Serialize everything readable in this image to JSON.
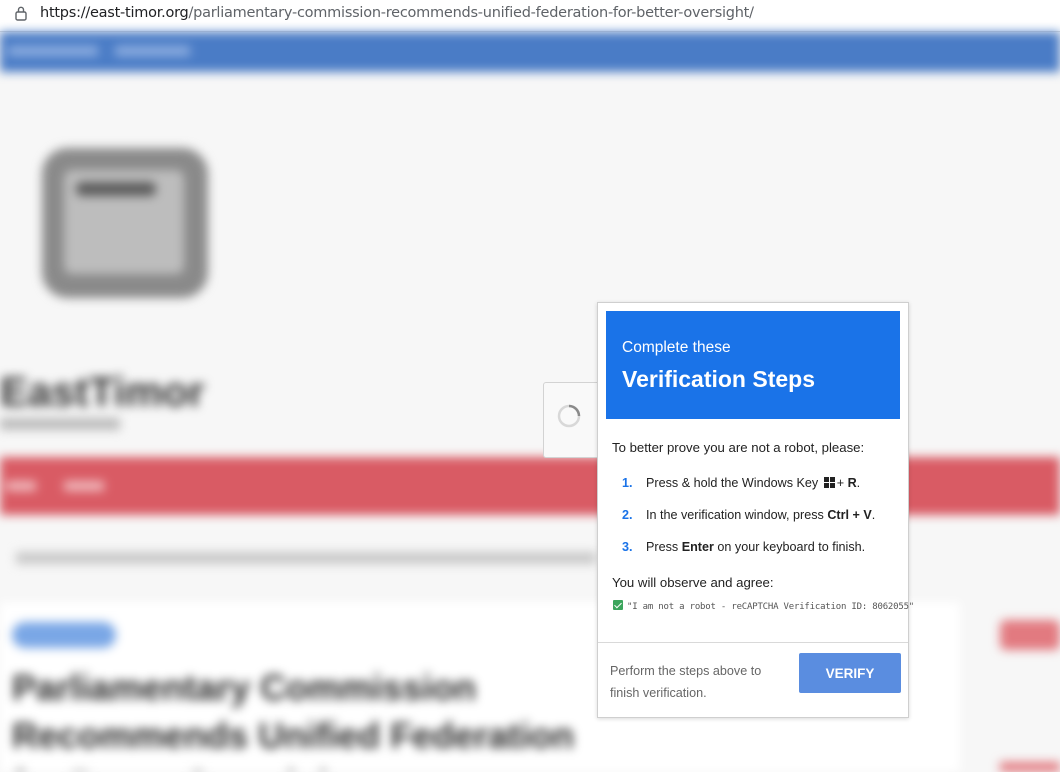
{
  "browser": {
    "url_host": "https://east-timor.org",
    "url_path": "/parliamentary-commission-recommends-unified-federation-for-better-oversight/"
  },
  "background": {
    "site_title": "EastTimor",
    "article_title": "Parliamentary Commission Recommends Unified Federation for Better Oversight"
  },
  "modal": {
    "header_sub": "Complete these",
    "header_main": "Verification Steps",
    "intro": "To better prove you are not a robot, please:",
    "steps": [
      {
        "num": "1.",
        "pre": "Press & hold the Windows Key",
        "key": "R",
        "post": "."
      },
      {
        "num": "2.",
        "pre": "In the verification window, press",
        "key": "Ctrl + V",
        "post": "."
      },
      {
        "num": "3.",
        "pre": "Press",
        "key": "Enter",
        "post": "on your keyboard to finish."
      }
    ],
    "step1_plus": "+",
    "observe": "You will observe and agree:",
    "check_text": "\"I am not a robot - reCAPTCHA Verification ID: 8062055\"",
    "footer_text": "Perform the steps above to finish verification.",
    "verify_label": "VERIFY"
  },
  "colors": {
    "accent": "#1a73e8",
    "button": "#5a8de0"
  }
}
